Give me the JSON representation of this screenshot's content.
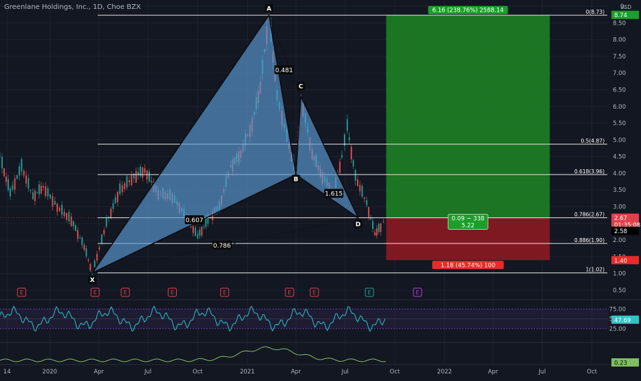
{
  "header": {
    "title": "Greenlane Holdings, Inc., 1D, Choe BZX"
  },
  "colors": {
    "background": "#131722",
    "pattern_fill": "#5b9bd5",
    "profit_zone": "#1b7a24",
    "loss_zone": "#8b1a22",
    "rsi_line": "#2ec4c4",
    "rsi_band": "#6a3fb5",
    "indicator_line": "#7fbf5f",
    "earnings_red": "#e0404a",
    "earnings_teal": "#26a69a",
    "earnings_purple": "#b040d0"
  },
  "chart_data": {
    "type": "line",
    "series_type": "candlestick",
    "currency": "USD",
    "y_axis": {
      "ticks": [
        "9.",
        "8.50",
        "8.00",
        "7.50",
        "7.00",
        "6.50",
        "6.00",
        "5.50",
        "5.00",
        "4.50",
        "4.00",
        "3.50",
        "3.00",
        "2.50",
        "2.00",
        "1.50",
        "1.00",
        "0.50"
      ],
      "tick_values": [
        9.0,
        8.5,
        8.0,
        7.5,
        7.0,
        6.5,
        6.0,
        5.5,
        5.0,
        4.5,
        4.0,
        3.5,
        3.0,
        2.5,
        2.0,
        1.5,
        1.0,
        0.5
      ],
      "range": [
        0.3,
        9.25
      ]
    },
    "x_axis": {
      "ticks": [
        "14",
        "2020",
        "Apr",
        "Jul",
        "Oct",
        "2021",
        "Apr",
        "Jul",
        "Oct",
        "2022",
        "Apr",
        "Jul",
        "Oct"
      ],
      "tick_dates": [
        "2019-10-14",
        "2020-01-01",
        "2020-04-01",
        "2020-07-01",
        "2020-10-01",
        "2021-01-01",
        "2021-04-01",
        "2021-07-01",
        "2021-10-01",
        "2022-01-01",
        "2022-04-01",
        "2022-07-01",
        "2022-10-01"
      ],
      "range": [
        "2019-10-01",
        "2022-11-01"
      ]
    },
    "price_approx": [
      [
        "2019-10-01",
        4.5
      ],
      [
        "2019-10-20",
        3.4
      ],
      [
        "2019-11-10",
        4.2
      ],
      [
        "2019-12-01",
        3.3
      ],
      [
        "2019-12-20",
        3.6
      ],
      [
        "2020-01-15",
        3.0
      ],
      [
        "2020-02-10",
        2.6
      ],
      [
        "2020-03-05",
        1.8
      ],
      [
        "2020-03-20",
        1.02
      ],
      [
        "2020-04-15",
        2.5
      ],
      [
        "2020-05-10",
        3.5
      ],
      [
        "2020-06-05",
        3.9
      ],
      [
        "2020-06-25",
        4.1
      ],
      [
        "2020-07-20",
        3.4
      ],
      [
        "2020-08-15",
        3.3
      ],
      [
        "2020-09-10",
        2.7
      ],
      [
        "2020-10-01",
        2.1
      ],
      [
        "2020-10-20",
        2.6
      ],
      [
        "2020-11-10",
        3.0
      ],
      [
        "2020-12-01",
        4.2
      ],
      [
        "2020-12-20",
        4.6
      ],
      [
        "2021-01-10",
        5.5
      ],
      [
        "2021-01-25",
        6.6
      ],
      [
        "2021-02-10",
        8.73
      ],
      [
        "2021-02-25",
        6.3
      ],
      [
        "2021-03-15",
        5.1
      ],
      [
        "2021-04-01",
        3.96
      ],
      [
        "2021-04-10",
        6.3
      ],
      [
        "2021-05-01",
        4.6
      ],
      [
        "2021-05-20",
        3.9
      ],
      [
        "2021-06-10",
        3.4
      ],
      [
        "2021-06-25",
        4.5
      ],
      [
        "2021-07-05",
        5.4
      ],
      [
        "2021-07-20",
        3.9
      ],
      [
        "2021-08-10",
        3.1
      ],
      [
        "2021-08-25",
        2.2
      ],
      [
        "2021-09-05",
        2.4
      ],
      [
        "2021-09-15",
        2.67
      ]
    ],
    "harmonic_pattern": {
      "points": [
        {
          "label": "X",
          "date": "2020-03-20",
          "price": 1.02
        },
        {
          "label": "A",
          "date": "2021-02-10",
          "price": 8.73
        },
        {
          "label": "B",
          "date": "2021-04-01",
          "price": 3.96
        },
        {
          "label": "C",
          "date": "2021-04-10",
          "price": 6.3
        },
        {
          "label": "D",
          "date": "2021-07-25",
          "price": 2.67
        }
      ],
      "ratios": [
        {
          "label": "0.481",
          "date": "2021-03-10",
          "price": 7.1
        },
        {
          "label": "1.615",
          "date": "2021-06-10",
          "price": 3.4
        },
        {
          "label": "0.607",
          "date": "2020-09-25",
          "price": 2.61
        },
        {
          "label": "0.786",
          "date": "2020-11-15",
          "price": 1.85
        }
      ]
    },
    "fib_levels": [
      {
        "label": "0(8.73)",
        "value": 8.73
      },
      {
        "label": "0.5(4.87)",
        "value": 4.87
      },
      {
        "label": "0.618(3.96)",
        "value": 3.96
      },
      {
        "label": "0.786(2.67)",
        "value": 2.67
      },
      {
        "label": "0.886(1.90)",
        "value": 1.9
      },
      {
        "label": "1(1.02)",
        "value": 1.02
      }
    ],
    "position": {
      "start_date": "2021-09-15",
      "end_date": "2022-07-15",
      "entry": 2.67,
      "target": 8.74,
      "stop": 1.4,
      "target_label": "6.16 (238.76%) 2588.14",
      "stop_label": "1.18 (45.74%) 100",
      "entry_label_line1": "0.09 ~ 338",
      "entry_label_line2": "5.22"
    },
    "price_tags": [
      {
        "label": "8.74",
        "value": 8.74,
        "color": "#1b9e2a"
      },
      {
        "label": "2.67",
        "value": 2.67,
        "color": "#e0404a"
      },
      {
        "label": "01:35:08",
        "value": 2.47,
        "color": "#e0404a"
      },
      {
        "label": "2.58",
        "value": 2.28,
        "color": "#000000"
      },
      {
        "label": "1.40",
        "value": 1.4,
        "color": "#e82a2a"
      }
    ],
    "earnings_markers": [
      {
        "label": "E",
        "date": "2019-11-10",
        "color": "red"
      },
      {
        "label": "E",
        "date": "2020-03-25",
        "color": "red"
      },
      {
        "label": "E",
        "date": "2020-05-20",
        "color": "red"
      },
      {
        "label": "E",
        "date": "2020-08-15",
        "color": "red"
      },
      {
        "label": "E",
        "date": "2020-11-20",
        "color": "red"
      },
      {
        "label": "E",
        "date": "2021-03-20",
        "color": "red"
      },
      {
        "label": "E",
        "date": "2021-05-05",
        "color": "red"
      },
      {
        "label": "E",
        "date": "2021-08-15",
        "color": "teal"
      },
      {
        "label": "E",
        "date": "2021-11-12",
        "color": "purple"
      }
    ],
    "rsi": {
      "ticks": [
        "75.00",
        "50.00",
        "25.00"
      ],
      "tick_values": [
        75,
        50,
        25
      ],
      "current_label": "47.69",
      "current": 47.69
    },
    "indicator2": {
      "current_label": "0.23",
      "current": 0.23
    }
  }
}
